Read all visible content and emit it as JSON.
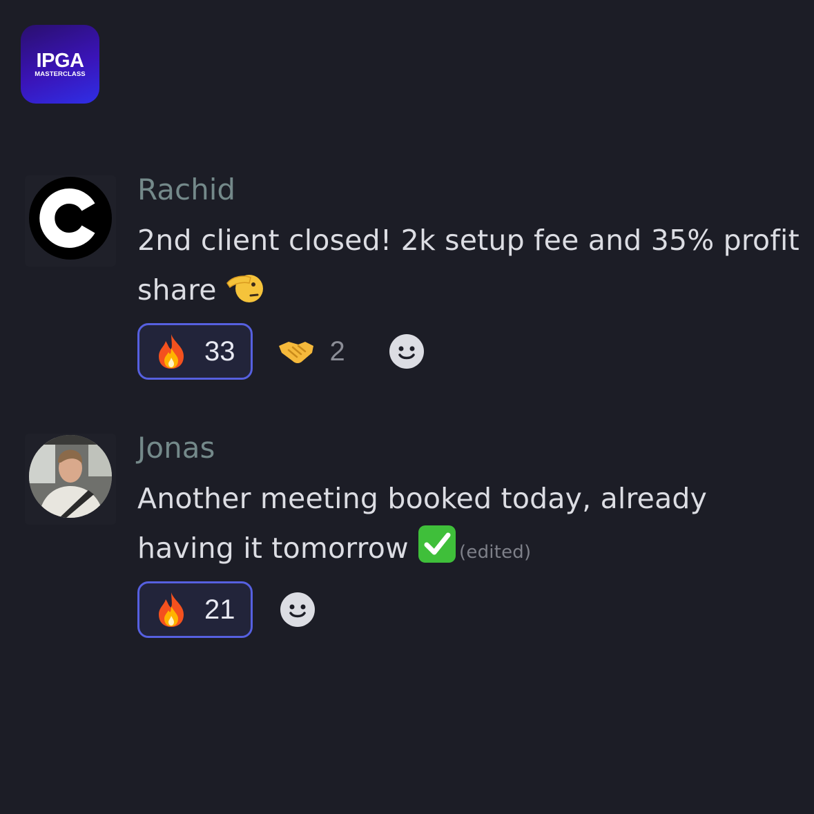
{
  "logo": {
    "main": "IPGA",
    "sub": "MASTERCLASS"
  },
  "messages": [
    {
      "author": "Rachid",
      "text": "2nd client closed! 2k setup fee and 35% profit share",
      "reactions": [
        {
          "emoji": "fire-icon",
          "count": "33",
          "active": true
        },
        {
          "emoji": "handshake-icon",
          "count": "2",
          "active": false
        }
      ]
    },
    {
      "author": "Jonas",
      "text": "Another meeting booked today, already having it tomorrow",
      "edited": "(edited)",
      "reactions": [
        {
          "emoji": "fire-icon",
          "count": "21",
          "active": true
        }
      ]
    }
  ],
  "colors": {
    "background": "#1c1d26",
    "author": "#74898a",
    "reaction_border": "#5660e0"
  }
}
